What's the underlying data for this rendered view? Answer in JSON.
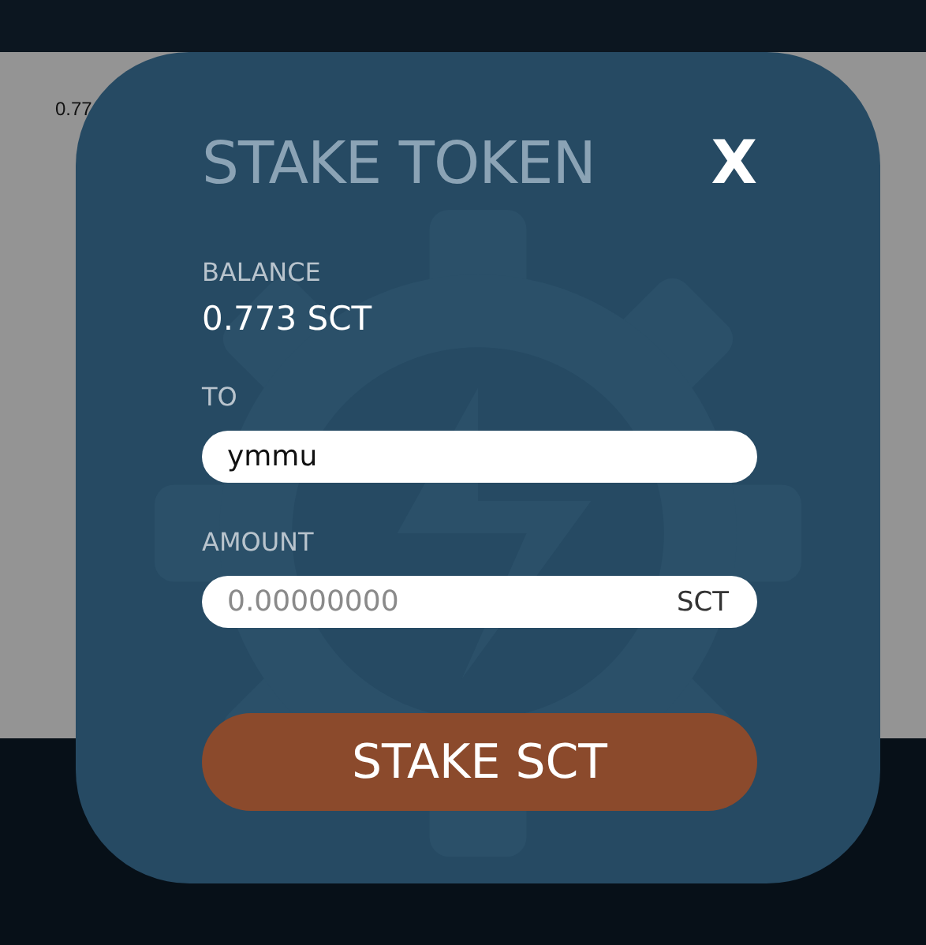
{
  "background": {
    "balance_text": "0.77"
  },
  "modal": {
    "title": "STAKE TOKEN",
    "close": "X",
    "balance": {
      "label": "BALANCE",
      "value": "0.773 SCT"
    },
    "to": {
      "label": "TO",
      "value": "ymmu"
    },
    "amount": {
      "label": "AMOUNT",
      "placeholder": "0.00000000",
      "unit": "SCT"
    },
    "submit": "STAKE SCT"
  }
}
